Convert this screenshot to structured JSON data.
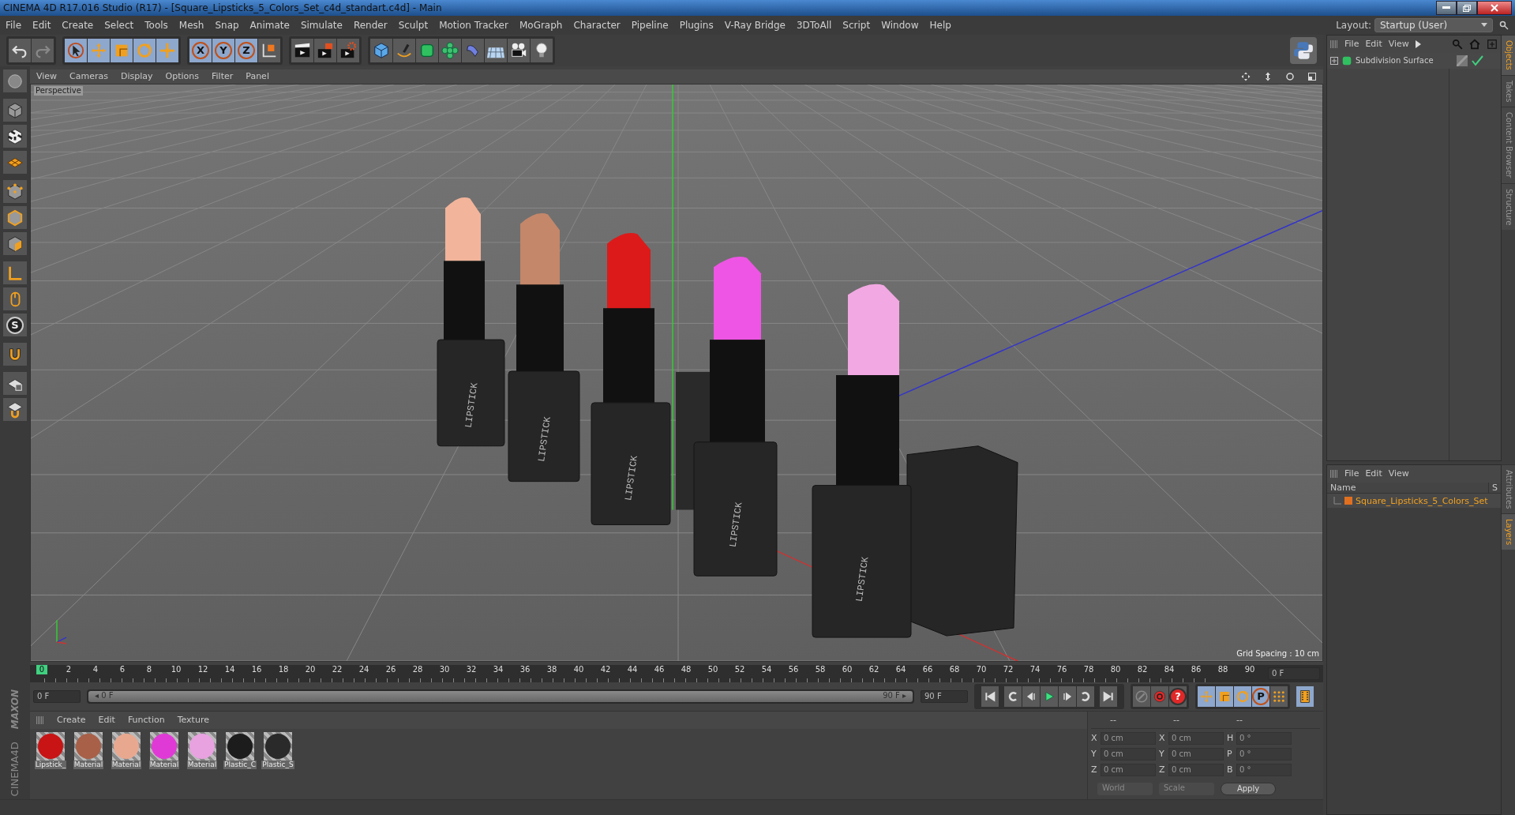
{
  "window": {
    "title": "CINEMA 4D R17.016 Studio (R17) - [Square_Lipsticks_5_Colors_Set_c4d_standart.c4d] - Main"
  },
  "menu": [
    "File",
    "Edit",
    "Create",
    "Select",
    "Tools",
    "Mesh",
    "Snap",
    "Animate",
    "Simulate",
    "Render",
    "Sculpt",
    "Motion Tracker",
    "MoGraph",
    "Character",
    "Pipeline",
    "Plugins",
    "V-Ray Bridge",
    "3DToAll",
    "Script",
    "Window",
    "Help"
  ],
  "layout": {
    "label": "Layout:",
    "value": "Startup (User)"
  },
  "toolbar": [
    [
      {
        "kind": "undo",
        "selected": false,
        "disabled": false
      },
      {
        "kind": "redo",
        "selected": false,
        "disabled": true
      }
    ],
    [
      {
        "kind": "select",
        "selected": true,
        "disabled": false
      },
      {
        "kind": "move",
        "selected": true,
        "disabled": false
      },
      {
        "kind": "scale",
        "selected": true,
        "disabled": false
      },
      {
        "kind": "rotate",
        "selected": true,
        "disabled": false
      },
      {
        "kind": "transform",
        "selected": true,
        "disabled": false
      }
    ],
    [
      {
        "kind": "letter",
        "label": "X",
        "selected": true,
        "disabled": false
      },
      {
        "kind": "letter",
        "label": "Y",
        "selected": true,
        "disabled": false
      },
      {
        "kind": "letter",
        "label": "Z",
        "selected": true,
        "disabled": false
      },
      {
        "kind": "coords",
        "selected": false,
        "disabled": false
      }
    ],
    [
      {
        "kind": "render",
        "selected": false,
        "disabled": false
      },
      {
        "kind": "renderpic",
        "selected": false,
        "disabled": false
      },
      {
        "kind": "rendersettings",
        "selected": false,
        "disabled": false
      }
    ],
    [
      {
        "kind": "cube",
        "selected": false,
        "disabled": false
      },
      {
        "kind": "pen",
        "selected": false,
        "disabled": false
      },
      {
        "kind": "subdiv",
        "selected": false,
        "disabled": false
      },
      {
        "kind": "cloner",
        "selected": false,
        "disabled": false
      },
      {
        "kind": "deformer",
        "selected": false,
        "disabled": false
      },
      {
        "kind": "floor",
        "selected": false,
        "disabled": false
      },
      {
        "kind": "camera",
        "selected": false,
        "disabled": false
      },
      {
        "kind": "light",
        "selected": false,
        "disabled": false
      }
    ]
  ],
  "left_toolbar": [
    [
      {
        "kind": "sphere"
      }
    ],
    [
      {
        "kind": "model"
      },
      {
        "kind": "texture"
      },
      {
        "kind": "workplane"
      }
    ],
    [
      {
        "kind": "points"
      },
      {
        "kind": "edges"
      },
      {
        "kind": "polygons"
      }
    ],
    [
      {
        "kind": "axis"
      },
      {
        "kind": "tweak"
      },
      {
        "kind": "letter",
        "label": "S"
      }
    ],
    [
      {
        "kind": "magnet"
      }
    ],
    [
      {
        "kind": "gridlock"
      },
      {
        "kind": "gridsnap"
      }
    ]
  ],
  "logo": {
    "brand": "MAXON",
    "product": "CINEMA4D"
  },
  "viewport": {
    "menu": [
      "View",
      "Cameras",
      "Display",
      "Options",
      "Filter",
      "Panel"
    ],
    "camera_label": "Perspective",
    "grid_spacing": "Grid Spacing : 10 cm",
    "lipsticks": [
      {
        "label": "LIPSTICK",
        "color": "#f2b49a"
      },
      {
        "label": "LIPSTICK",
        "color": "#c4876a"
      },
      {
        "label": "LIPSTICK",
        "color": "#dc1a1a"
      },
      {
        "label": "LIPSTICK",
        "color": "#ee55e4"
      },
      {
        "label": "LIPSTICK",
        "color": "#f2a8e2"
      }
    ]
  },
  "timeline": {
    "ticks": [
      "0",
      "2",
      "4",
      "6",
      "8",
      "10",
      "12",
      "14",
      "16",
      "18",
      "20",
      "22",
      "24",
      "26",
      "28",
      "30",
      "32",
      "34",
      "36",
      "38",
      "40",
      "42",
      "44",
      "46",
      "48",
      "50",
      "52",
      "54",
      "56",
      "58",
      "60",
      "62",
      "64",
      "66",
      "68",
      "70",
      "72",
      "74",
      "76",
      "78",
      "80",
      "82",
      "84",
      "86",
      "88",
      "90"
    ],
    "current_frame": "0 F",
    "start_field": "0 F",
    "range": {
      "start": "◂ 0 F",
      "end": "90 F ▸",
      "level": 1
    },
    "end_field": "90 F"
  },
  "transport": [
    {
      "kind": "first"
    },
    {
      "kind": "prevkey"
    },
    {
      "kind": "prevframe"
    },
    {
      "kind": "play"
    },
    {
      "kind": "nextframe"
    },
    {
      "kind": "nextkey"
    },
    {
      "kind": "last"
    }
  ],
  "record": [
    {
      "kind": "keyrec"
    },
    {
      "kind": "autokey"
    },
    {
      "kind": "letter",
      "label": "?"
    }
  ],
  "modes": [
    {
      "kind": "move",
      "selected": true
    },
    {
      "kind": "scale",
      "selected": true
    },
    {
      "kind": "rotate",
      "selected": true
    },
    {
      "kind": "letter",
      "label": "P",
      "selected": true
    },
    {
      "kind": "dots",
      "selected": false
    }
  ],
  "materials": {
    "menu": [
      "Create",
      "Edit",
      "Function",
      "Texture"
    ],
    "items": [
      {
        "label": "Lipstick_",
        "color": "#c81414"
      },
      {
        "label": "Material",
        "color": "#a86048"
      },
      {
        "label": "Material",
        "color": "#e8a890"
      },
      {
        "label": "Material",
        "color": "#e03ad6"
      },
      {
        "label": "Material",
        "color": "#e8a2e0"
      },
      {
        "label": "Plastic_C",
        "color": "#1c1c1c"
      },
      {
        "label": "Plastic_S",
        "color": "#2a2a2a"
      }
    ]
  },
  "coordinates": {
    "headers": [
      "--",
      "--",
      "--"
    ],
    "rows": [
      [
        {
          "axis": "X",
          "value": "0 cm"
        },
        {
          "axis": "X",
          "value": "0 cm"
        },
        {
          "axis": "H",
          "value": "0 °"
        }
      ],
      [
        {
          "axis": "Y",
          "value": "0 cm"
        },
        {
          "axis": "Y",
          "value": "0 cm"
        },
        {
          "axis": "P",
          "value": "0 °"
        }
      ],
      [
        {
          "axis": "Z",
          "value": "0 cm"
        },
        {
          "axis": "Z",
          "value": "0 cm"
        },
        {
          "axis": "B",
          "value": "0 °"
        }
      ]
    ],
    "mode": "World",
    "transform": "Scale",
    "apply": "Apply"
  },
  "objects": {
    "menu": [
      "File",
      "Edit",
      "View"
    ],
    "items": [
      {
        "name": "Subdivision Surface",
        "checked": true
      }
    ]
  },
  "layers": {
    "menu": [
      "File",
      "Edit",
      "View"
    ],
    "columns": [
      "Name",
      "S"
    ],
    "items": [
      {
        "name": "Square_Lipsticks_5_Colors_Set",
        "color": "#e07020"
      }
    ]
  },
  "side_tabs": [
    {
      "label": "Objects",
      "selected": true
    },
    {
      "label": "Takes",
      "selected": false
    },
    {
      "label": "Content Browser",
      "selected": false
    },
    {
      "label": "Structure",
      "selected": false
    }
  ],
  "side_tabs_lower": [
    {
      "label": "Attributes",
      "selected": false
    },
    {
      "label": "Layers",
      "selected": true
    }
  ]
}
